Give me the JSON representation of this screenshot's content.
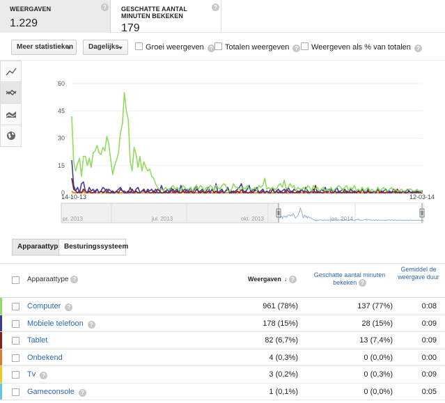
{
  "metrics": [
    {
      "label": "WEERGAVEN",
      "value": "1.229"
    },
    {
      "label": "GESCHATTE AANTAL MINUTEN BEKEKEN",
      "value": "179"
    }
  ],
  "toolbar": {
    "more_stats": "Meer statistieken",
    "period": "Dagelijks",
    "checkboxes": [
      "Groei weergeven",
      "Totalen weergeven",
      "Weergeven als % van totalen"
    ]
  },
  "help_glyph": "?",
  "colors": {
    "computer": "#8fdc5f",
    "mobile": "#3d3d99",
    "tablet": "#8b1a1a",
    "unknown": "#e8772e",
    "tv": "#f2c81e",
    "console": "#5fc6e6"
  },
  "chart_data": {
    "type": "line",
    "x_start": "14-10-13",
    "x_end": "12-03-14",
    "yticks": [
      "60",
      "45",
      "30",
      "15",
      "0"
    ],
    "ylim": [
      0,
      60
    ],
    "series": [
      {
        "name": "Computer",
        "color": "#8fdc5f",
        "values": [
          42,
          17,
          12,
          16,
          19,
          9,
          20,
          20,
          15,
          19,
          14,
          22,
          23,
          26,
          22,
          21,
          25,
          23,
          31,
          27,
          18,
          10,
          15,
          18,
          22,
          33,
          38,
          55,
          45,
          40,
          17,
          12,
          25,
          21,
          14,
          20,
          12,
          17,
          14,
          12,
          13,
          9,
          8,
          5,
          3,
          2,
          2,
          1,
          3,
          2,
          2,
          3,
          4,
          2,
          3,
          2,
          1,
          4,
          3,
          2,
          2,
          3,
          1,
          3,
          4,
          2,
          4,
          3,
          1,
          3,
          2,
          4,
          3,
          1,
          4,
          3,
          2,
          4,
          5,
          4,
          1,
          1,
          2,
          5,
          3,
          3,
          2,
          2,
          3,
          2,
          4,
          2,
          2,
          2,
          3,
          1,
          4,
          3,
          4,
          8,
          2,
          3,
          2,
          3,
          2,
          2,
          4,
          5,
          3,
          7,
          2,
          3,
          5,
          3,
          4,
          1,
          3,
          2,
          2,
          3,
          1,
          4,
          3,
          1,
          4,
          2,
          3,
          1,
          2,
          3,
          1,
          2,
          1,
          3,
          1,
          2,
          3,
          4,
          3,
          1,
          3,
          4,
          1,
          3,
          2,
          4,
          1,
          2,
          1,
          3,
          1,
          2,
          3,
          1,
          2,
          1,
          1,
          3,
          1,
          2,
          3,
          1,
          1,
          2,
          3,
          1,
          2,
          1,
          1,
          2,
          1,
          1,
          2,
          2,
          2,
          1,
          1,
          2,
          1,
          1,
          0
        ]
      },
      {
        "name": "Mobiele telefoon",
        "color": "#3d3d99",
        "values": [
          18,
          4,
          1,
          3,
          0,
          5,
          6,
          1,
          0,
          3,
          1,
          2,
          0,
          2,
          0,
          1,
          3,
          2,
          0,
          2,
          1,
          0,
          0,
          1,
          2,
          3,
          1,
          1,
          0,
          0,
          3,
          0,
          0,
          2,
          3,
          0,
          1,
          1,
          0,
          2,
          1,
          2,
          0,
          2,
          0,
          0,
          4,
          1,
          0,
          2,
          0,
          3,
          0,
          1,
          2,
          0,
          4,
          1,
          2,
          0,
          1,
          3,
          0,
          2,
          4,
          0,
          1,
          2,
          0,
          1,
          3,
          0,
          2,
          1,
          5,
          0,
          1,
          2,
          0,
          1,
          3,
          0,
          1,
          0,
          1,
          2,
          3,
          5,
          1,
          0,
          2,
          4,
          0,
          2,
          1,
          3,
          0,
          1,
          2,
          0,
          1,
          0,
          2,
          3,
          0,
          1,
          2,
          0,
          1,
          2,
          0,
          3,
          1,
          0,
          2,
          1,
          0,
          1,
          2,
          0,
          3,
          1,
          0,
          1,
          2,
          0,
          1,
          0,
          2,
          1,
          3,
          0,
          1,
          2,
          0,
          1,
          3,
          0,
          1,
          2,
          0,
          1,
          0,
          2,
          1,
          0,
          1,
          2,
          0,
          3,
          1,
          0,
          2,
          1,
          0,
          1,
          0,
          3,
          1,
          0,
          1,
          2,
          0,
          1,
          0,
          2,
          1,
          0,
          1,
          0,
          1,
          0,
          2,
          1,
          0,
          1,
          0,
          1,
          0,
          1,
          1
        ]
      },
      {
        "name": "Tablet",
        "color": "#8b1a1a",
        "values": [
          8,
          2,
          1,
          0,
          1,
          0,
          2,
          1,
          0,
          1,
          0,
          0,
          1,
          2,
          0,
          1,
          0,
          1,
          2,
          0,
          0,
          1,
          0,
          1,
          0,
          2,
          1,
          0,
          0,
          1,
          0,
          2,
          0,
          1,
          0,
          0,
          1,
          2,
          0,
          1,
          0,
          0,
          1,
          0,
          2,
          1,
          0,
          0,
          1,
          0,
          0,
          1,
          2,
          0,
          1,
          0,
          0,
          1,
          0,
          2,
          0,
          1,
          0,
          0,
          2,
          1,
          0,
          1,
          0,
          0,
          1,
          0,
          2,
          0,
          1,
          0,
          0,
          1,
          0,
          1,
          2,
          0,
          0,
          1,
          0,
          1,
          0,
          2,
          0,
          1,
          0,
          0,
          1,
          0,
          2,
          1,
          0,
          0,
          1,
          0,
          1,
          0,
          0,
          2,
          0,
          1,
          0,
          1,
          0,
          0,
          2,
          1,
          0,
          1,
          0,
          0,
          1,
          0,
          2,
          0,
          1,
          0,
          0,
          1,
          0,
          4,
          0,
          1,
          0,
          0,
          1,
          0,
          2,
          0,
          0,
          1,
          0,
          1,
          0,
          0,
          2,
          0,
          1,
          0,
          0,
          1,
          0,
          1,
          0,
          2,
          0,
          0,
          1,
          0,
          0,
          1,
          0,
          2,
          0,
          1,
          0,
          0,
          1,
          0,
          0,
          1,
          0,
          2,
          0,
          0,
          1,
          0,
          0,
          1,
          0,
          0,
          1,
          0,
          1,
          0,
          0
        ]
      },
      {
        "name": "Onbekend",
        "color": "#e8772e",
        "values": [
          1,
          0,
          0,
          0,
          0,
          0,
          1,
          0,
          0,
          0,
          0,
          0,
          0,
          0,
          0,
          1,
          0,
          0,
          0,
          0,
          0,
          0,
          0,
          0,
          0,
          0,
          0,
          0,
          0,
          0,
          0,
          0,
          0,
          0,
          0,
          0,
          0,
          0,
          0,
          0,
          0,
          0,
          0,
          0,
          0,
          0,
          0,
          0,
          0,
          0,
          0,
          0,
          0,
          0,
          0,
          0,
          0,
          1,
          0,
          0,
          0,
          0,
          0,
          0,
          0,
          0,
          0,
          0,
          0,
          0,
          0,
          0,
          0,
          0,
          0,
          0,
          0,
          0,
          0,
          0,
          0,
          0,
          0,
          0,
          0,
          0,
          0,
          0,
          0,
          0,
          0,
          0,
          0,
          0,
          0,
          0,
          0,
          0,
          0,
          0,
          0,
          0,
          0,
          0,
          0,
          0,
          0,
          0,
          0,
          0,
          0,
          0,
          0,
          0,
          0,
          0,
          0,
          0,
          0,
          0,
          0,
          0,
          0,
          0,
          0,
          0,
          0,
          0,
          0,
          0,
          0,
          0,
          0,
          0,
          0,
          0,
          0,
          0,
          0,
          0,
          0,
          0,
          0,
          1,
          0,
          0,
          0,
          0,
          0,
          0,
          0,
          0,
          0,
          0,
          0,
          0,
          0,
          0,
          0,
          0,
          0,
          0,
          0,
          0,
          0,
          0,
          0,
          0,
          0,
          0,
          0,
          0,
          0,
          0,
          0,
          0,
          0,
          0,
          0,
          0
        ]
      },
      {
        "name": "Tv",
        "color": "#f2c81e",
        "values": [
          0,
          0,
          0,
          0,
          0,
          0,
          0,
          0,
          0,
          0,
          0,
          0,
          0,
          0,
          0,
          0,
          0,
          0,
          0,
          0,
          0,
          0,
          0,
          0,
          0,
          0,
          0,
          0,
          0,
          0,
          0,
          0,
          0,
          0,
          0,
          0,
          0,
          0,
          0,
          0,
          0,
          0,
          0,
          0,
          0,
          0,
          0,
          0,
          0,
          0,
          0,
          0,
          0,
          0,
          0,
          0,
          0,
          0,
          0,
          0,
          0,
          0,
          0,
          0,
          0,
          0,
          0,
          0,
          0,
          0,
          0,
          0,
          0,
          0,
          0,
          0,
          0,
          0,
          0,
          0,
          0,
          0,
          0,
          0,
          0,
          0,
          0,
          0,
          0,
          0,
          0,
          0,
          0,
          0,
          0,
          0,
          0,
          0,
          0,
          0,
          0,
          0,
          0,
          0,
          0,
          0,
          0,
          0,
          0,
          0,
          0,
          0,
          0,
          0,
          0,
          0,
          0,
          0,
          0,
          0,
          0,
          0,
          0,
          0,
          0,
          0,
          0,
          0,
          0,
          0,
          0,
          0,
          0,
          0,
          0,
          0,
          0,
          0,
          0,
          0,
          0,
          0,
          0,
          0,
          0,
          0,
          0,
          0,
          0,
          0,
          0,
          0,
          0,
          0,
          0,
          0,
          0,
          0,
          0,
          0,
          0,
          0,
          0,
          0,
          0,
          0,
          0,
          0,
          0,
          0,
          0,
          0,
          0,
          0,
          0,
          0,
          0,
          0,
          0,
          0
        ]
      }
    ],
    "navigator_labels": [
      "pr. 2013",
      "jul. 2013",
      "okt. 2013",
      "jan. 2014"
    ]
  },
  "dim_tabs": [
    "Apparaattype",
    "Besturingssysteem"
  ],
  "table": {
    "headers": {
      "dimension": "Apparaattype",
      "views": "Weergaven",
      "minutes": "Geschatte aantal minuten bekeken",
      "duration": "Gemiddel de weergave duur"
    },
    "sort_arrow": "↓",
    "rows": [
      {
        "name": "Computer",
        "views": "961 (78%)",
        "minutes": "137 (77%)",
        "duration": "0:08",
        "color": "#8fdc5f"
      },
      {
        "name": "Mobiele telefoon",
        "views": "178 (15%)",
        "minutes": "28 (15%)",
        "duration": "0:09",
        "color": "#3d3d99"
      },
      {
        "name": "Tablet",
        "views": "82 (6,7%)",
        "minutes": "13 (7,4%)",
        "duration": "0:09",
        "color": "#8b1a1a"
      },
      {
        "name": "Onbekend",
        "views": "4 (0,3%)",
        "minutes": "0 (0,0%)",
        "duration": "0:00",
        "color": "#e8772e"
      },
      {
        "name": "Tv",
        "views": "3 (0,2%)",
        "minutes": "0 (0,3%)",
        "duration": "0:09",
        "color": "#f2c81e"
      },
      {
        "name": "Gameconsole",
        "views": "1 (0,1%)",
        "minutes": "0 (0,0%)",
        "duration": "0:05",
        "color": "#5fc6e6"
      }
    ]
  }
}
